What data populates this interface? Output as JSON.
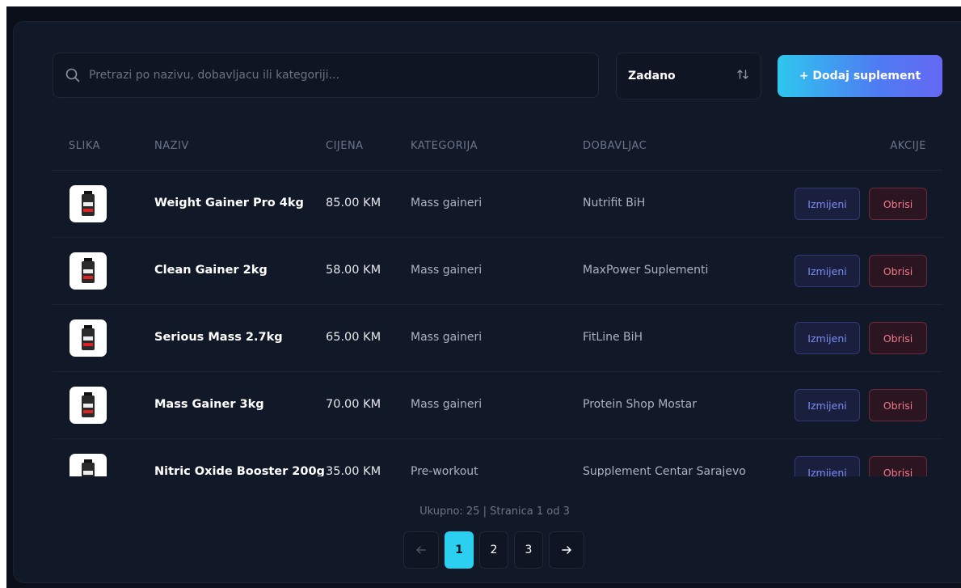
{
  "toolbar": {
    "search_placeholder": "Pretrazi po nazivu, dobavljacu ili kategoriji...",
    "search_value": "",
    "sort_label": "Zadano",
    "add_button_label": "+ Dodaj suplement"
  },
  "table": {
    "headers": {
      "image": "SLIKA",
      "name": "NAZIV",
      "price": "CIJENA",
      "category": "KATEGORIJA",
      "supplier": "DOBAVLJAC",
      "actions": "AKCIJE"
    },
    "edit_label": "Izmijeni",
    "delete_label": "Obrisi",
    "rows": [
      {
        "name": "Weight Gainer Pro 4kg",
        "price": "85.00 KM",
        "category": "Mass gaineri",
        "supplier": "Nutrifit BiH"
      },
      {
        "name": "Clean Gainer 2kg",
        "price": "58.00 KM",
        "category": "Mass gaineri",
        "supplier": "MaxPower Suplementi"
      },
      {
        "name": "Serious Mass 2.7kg",
        "price": "65.00 KM",
        "category": "Mass gaineri",
        "supplier": "FitLine BiH"
      },
      {
        "name": "Mass Gainer 3kg",
        "price": "70.00 KM",
        "category": "Mass gaineri",
        "supplier": "Protein Shop Mostar"
      },
      {
        "name": "Nitric Oxide Booster 200g",
        "price": "35.00 KM",
        "category": "Pre-workout",
        "supplier": "Supplement Centar Sarajevo"
      }
    ]
  },
  "pagination": {
    "summary": "Ukupno: 25 | Stranica 1 od 3",
    "prev_icon": "arrow-left-icon",
    "next_icon": "arrow-right-icon",
    "pages": [
      "1",
      "2",
      "3"
    ],
    "current": "1"
  },
  "colors": {
    "background": "#111827",
    "accent": "#2bd0f0",
    "edit": "#7c8cf8",
    "delete": "#f27a8c"
  }
}
